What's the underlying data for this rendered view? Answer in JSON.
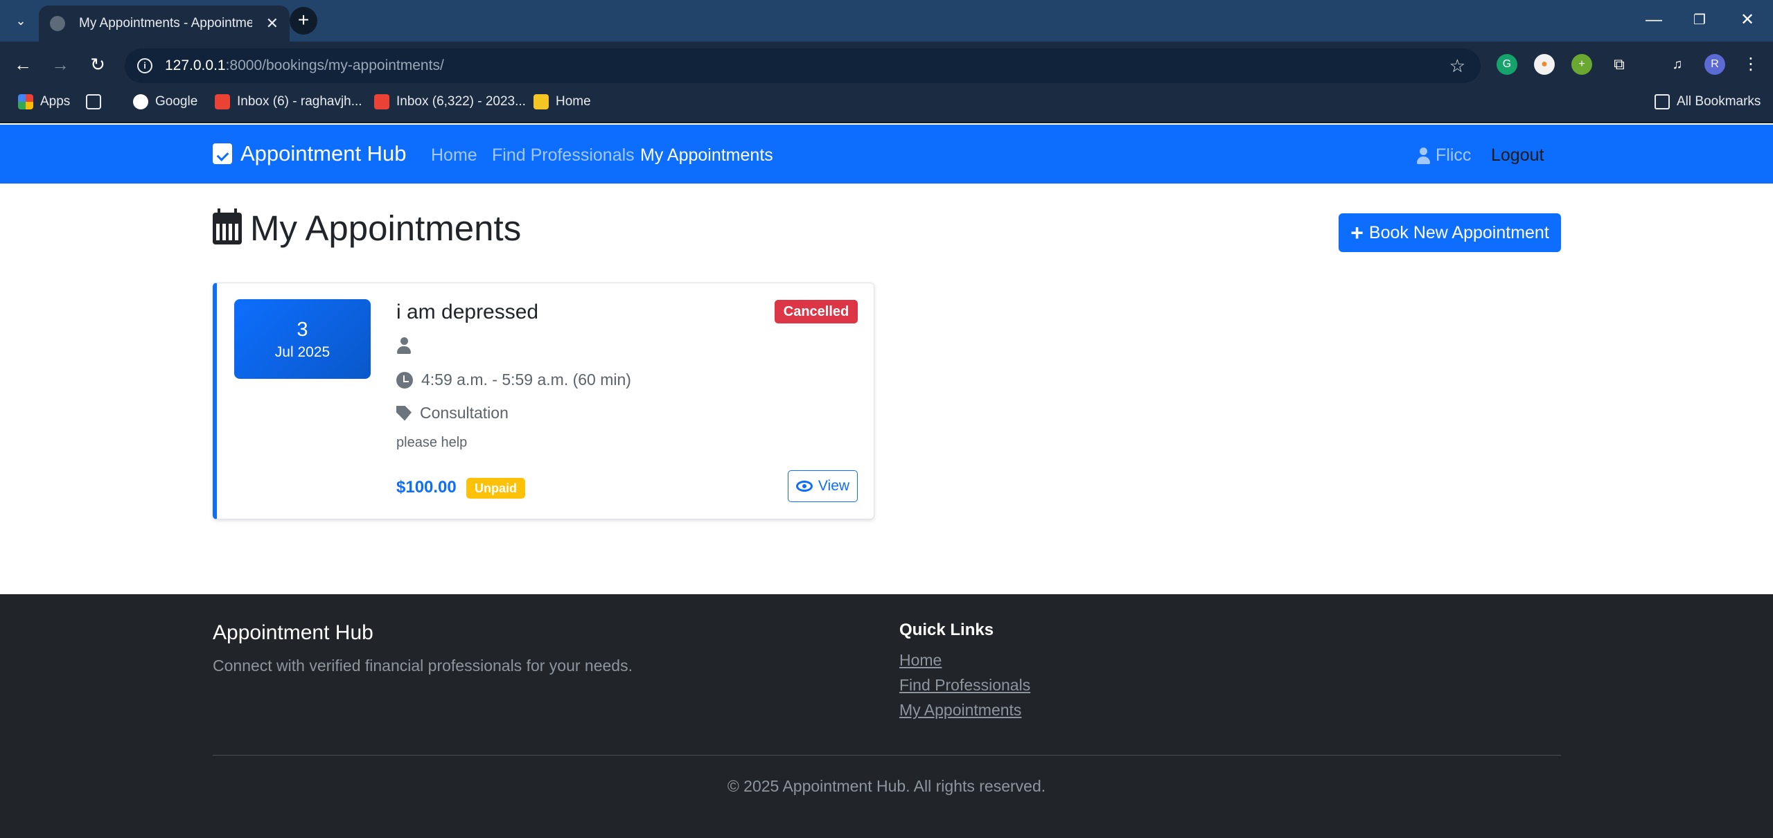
{
  "browser": {
    "tab_title": "My Appointments - Appointment Hub",
    "new_tab": "+",
    "url_host": "127.0.0.1",
    "url_path": ":8000/bookings/my-appointments/",
    "bookmarks": [
      {
        "label": "Apps"
      },
      {
        "label": "Google"
      },
      {
        "label": "Inbox (6) - raghavjh..."
      },
      {
        "label": "Inbox (6,322) - 2023..."
      },
      {
        "label": "Home"
      }
    ],
    "all_bookmarks": "All Bookmarks",
    "profile_initial": "R"
  },
  "navbar": {
    "brand": "Appointment Hub",
    "links": [
      "Home",
      "Find Professionals",
      "My Appointments"
    ],
    "user": "Flicc",
    "logout": "Logout"
  },
  "main": {
    "title": "My Appointments",
    "new_button": "Book New Appointment",
    "appointment": {
      "day": "3",
      "month_year": "Jul 2025",
      "title": "i am depressed",
      "status": "Cancelled",
      "time": "4:59 a.m. - 5:59 a.m. (60 min)",
      "type": "Consultation",
      "notes": "please help",
      "price": "$100.00",
      "payment": "Unpaid",
      "view": "View"
    }
  },
  "footer": {
    "brand": "Appointment Hub",
    "tagline": "Connect with verified financial professionals for your needs.",
    "quick_links_title": "Quick Links",
    "links": [
      "Home",
      "Find Professionals",
      "My Appointments"
    ],
    "copyright": "© 2025 Appointment Hub. All rights reserved."
  },
  "colors": {
    "primary": "#0d6efd",
    "danger": "#dc3545",
    "warning": "#ffc107",
    "footer_bg": "#212529"
  }
}
